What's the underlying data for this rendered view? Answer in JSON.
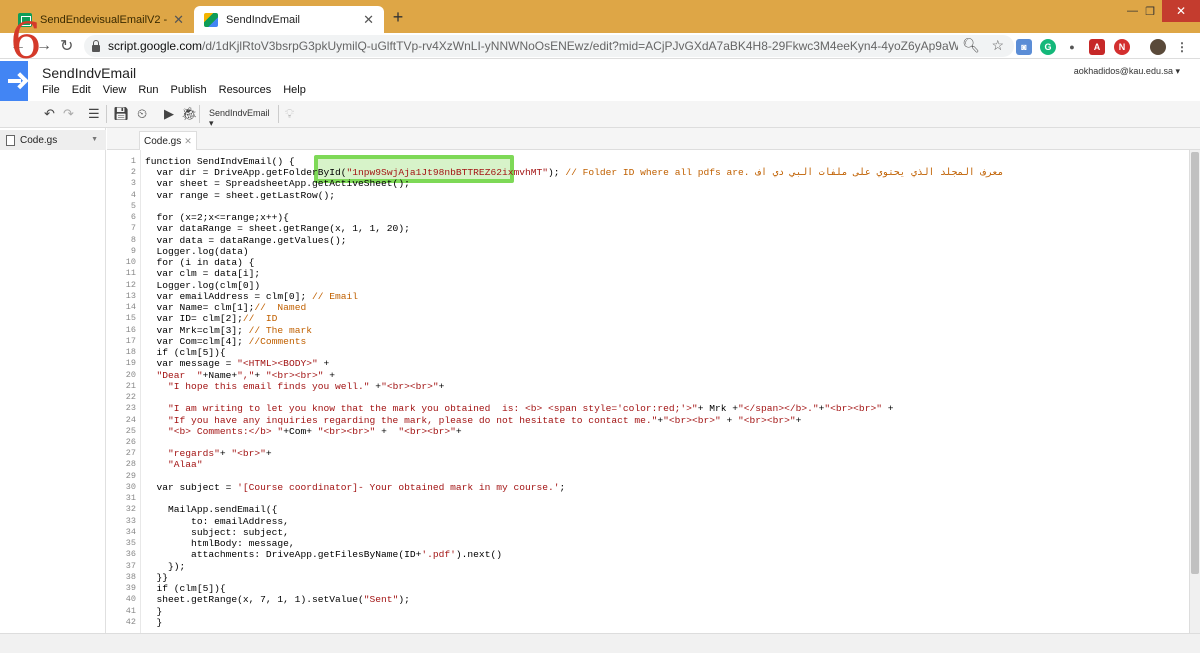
{
  "browser": {
    "tabs": [
      {
        "title": "SendEndevisualEmailV2 - Google",
        "active": false
      },
      {
        "title": "SendIndvEmail",
        "active": true
      }
    ],
    "new_tab": "+",
    "url_host": "script.google.com",
    "url_path": "/d/1dKjlRtoV3bsrpG3pkUymilQ-uGlftTVp-rv4XzWnLI-yNNWNoOsENEwz/edit?mid=ACjPJvGXdA7aBK4H8-29Fkwc3M4eeKyn4-4yoZ6yAp9aWevQc_jEqDX0..."
  },
  "annotation_number": "6",
  "app": {
    "project_title": "SendIndvEmail",
    "account": "aokhadidos@kau.edu.sa",
    "menu": [
      "File",
      "Edit",
      "View",
      "Run",
      "Publish",
      "Resources",
      "Help"
    ],
    "function_select": "SendIndvEmail"
  },
  "files": [
    {
      "name": "Code.gs"
    }
  ],
  "editor_tab": "Code.gs",
  "code_lines": [
    "function SendIndvEmail() {",
    "  var dir = DriveApp.getFolderById(\"1npw9SwjAja1Jt98nbBTTREZ62ixmvhMT\"); // Folder ID where all pdfs are. معرف المجلد الذي يحتوي على ملفات البي دي اف",
    "  var sheet = SpreadsheetApp.getActiveSheet();",
    "  var range = sheet.getLastRow();",
    "",
    "  for (x=2;x<=range;x++){",
    "  var dataRange = sheet.getRange(x, 1, 1, 20);",
    "  var data = dataRange.getValues();",
    "  Logger.log(data)",
    "  for (i in data) {",
    "  var clm = data[i];",
    "  Logger.log(clm[0])",
    "  var emailAddress = clm[0]; // Email",
    "  var Name= clm[1];//  Named",
    "  var ID= clm[2];//  ID",
    "  var Mrk=clm[3]; // The mark",
    "  var Com=clm[4]; //Comments",
    "  if (clm[5]){",
    "  var message = \"<HTML><BODY>\" +",
    "  \"Dear  \"+Name+\",\"+ \"<br><br>\" +",
    "    \"I hope this email finds you well.\" +\"<br><br>\"+",
    "",
    "    \"I am writing to let you know that the mark you obtained  is: <b> <span style='color:red;'>\"+ Mrk +\"</span></b>.\"+\"<br><br>\" +",
    "    \"If you have any inquiries regarding the mark, please do not hesitate to contact me.\"+\"<br><br>\" + \"<br><br>\"+",
    "    \"<b> Comments:</b> \"+Com+ \"<br><br>\" +  \"<br><br>\"+",
    "",
    "    \"regards\"+ \"<br>\"+",
    "    \"Alaa\"",
    "",
    "  var subject = '[Course coordinator]- Your obtained mark in my course.';",
    "",
    "    MailApp.sendEmail({",
    "        to: emailAddress,",
    "        subject: subject,",
    "        htmlBody: message,",
    "        attachments: DriveApp.getFilesByName(ID+'.pdf').next()",
    "    });",
    "  }}",
    "  if (clm[5]){",
    "  sheet.getRange(x, 7, 1, 1).setValue(\"Sent\");",
    "  }",
    "  }"
  ]
}
